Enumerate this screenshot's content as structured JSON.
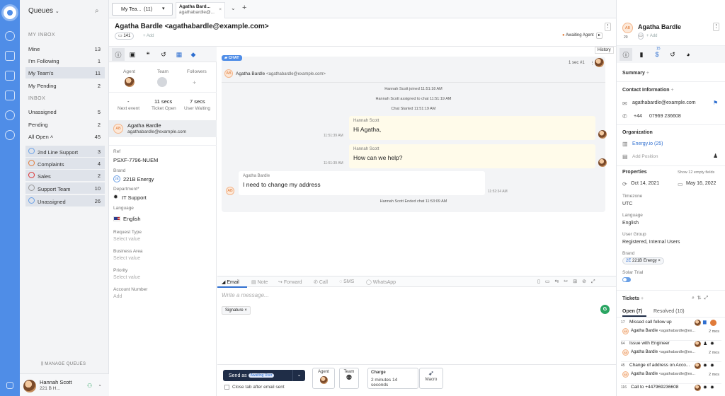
{
  "queues": {
    "title": "Queues",
    "my_inbox": "MY INBOX",
    "inbox": "INBOX",
    "manage": "MANAGE QUEUES",
    "my": [
      {
        "label": "Mine",
        "count": "13"
      },
      {
        "label": "I'm Following",
        "count": "1"
      },
      {
        "label": "My Team's",
        "count": "11"
      },
      {
        "label": "My Pending",
        "count": "2"
      }
    ],
    "inbox_items": [
      {
        "label": "Unassigned",
        "count": "5"
      },
      {
        "label": "Pending",
        "count": "2"
      },
      {
        "label": "All Open",
        "count": "45"
      }
    ],
    "sub": [
      {
        "label": "2nd Line Support",
        "count": "3"
      },
      {
        "label": "Complaints",
        "count": "4"
      },
      {
        "label": "Sales",
        "count": "2"
      },
      {
        "label": "Support Team",
        "count": "10"
      },
      {
        "label": "Unassigned",
        "count": "26"
      }
    ],
    "user": {
      "name": "Hannah Scott",
      "sub": "221 B H..."
    }
  },
  "tabs": {
    "team": "My Tea...",
    "team_count": "(11)",
    "active_title": "Agatha Bard...",
    "active_sub": "agathabardle@..."
  },
  "ticket": {
    "title": "Agatha Bardle <agathabardle@example.com>",
    "id": "141",
    "add": "+ Add",
    "status": "Awaiting Agent",
    "history": "History"
  },
  "props": {
    "agent": "Agent",
    "team": "Team",
    "followers": "Followers",
    "next_event_val": "-",
    "next_event": "Next event",
    "open_val": "11 secs",
    "open": "Ticket Open",
    "wait_val": "7 secs",
    "wait": "User Waiting",
    "contact_initials": "AB",
    "contact_name": "Agatha Bardle",
    "contact_email": "agathabardle@example.com",
    "ref_l": "Ref",
    "ref": "PSXF-7796-NUEM",
    "brand_l": "Brand",
    "brand_badge": "2E",
    "brand": "221B Energy",
    "dept_l": "Department*",
    "dept": "IT Support",
    "lang_l": "Language",
    "lang": "English",
    "req_l": "Request Type",
    "req": "Select value",
    "area_l": "Business Area",
    "area": "Select value",
    "prio_l": "Priority",
    "prio": "Select value",
    "acc_l": "Account Number",
    "acc": "Add"
  },
  "chat": {
    "badge": "CHAT",
    "who": "Agatha Bardle",
    "who_email": "<agathabardle@example.com>",
    "time": "1 sec",
    "num": "#1",
    "sys1": "Hannah Scott  joined   11:51:18 AM",
    "sys2": "Hannah Scott  assigned to chat   11:51:19 AM",
    "sys3": "Chat Started   11:51:19 AM",
    "m1_name": "Hannah Scott",
    "m1": "Hi Agatha,",
    "m1_t": "11:51:39 AM",
    "m2_name": "Hannah Scott",
    "m2": "How can we help?",
    "m2_t": "11:51:39 AM",
    "m3_name": "Agatha Bardle",
    "m3": "I need to change my address",
    "m3_t": "11:52:34 AM",
    "sys4": "Hannah Scott  Ended chat  11:53:09 AM"
  },
  "composer": {
    "email": "Email",
    "note": "Note",
    "forward": "Forward",
    "call": "Call",
    "sms": "SMS",
    "whatsapp": "WhatsApp",
    "placeholder": "Write a message...",
    "signature": "Signature ×",
    "send": "Send as",
    "send_badge": "Awaiting User",
    "close_tab": "Close tab after email sent",
    "agent": "Agent",
    "team": "Team",
    "charge": "Charge",
    "charge_val": "2 minutes 14 seconds",
    "macro": "Macro"
  },
  "contact": {
    "initials": "AB",
    "name": "Agatha Bardle",
    "count": "20",
    "add": "+ Add",
    "summary": "Summary",
    "info": "Contact Information",
    "email": "agathabardle@example.com",
    "phone_cc": "+44",
    "phone": "07969 236608",
    "org": "Organization",
    "org_name": "Energy.io (25)",
    "add_pos": "Add Position",
    "properties": "Properties",
    "show_empty": "Show 12 empty fields",
    "date1": "Oct 14, 2021",
    "date2": "May 16, 2022",
    "tz_l": "Timezone",
    "tz": "UTC",
    "lang_l": "Language",
    "lang": "English",
    "ug_l": "User Group",
    "ug": "Registered, Internal Users",
    "brand_l": "Brand",
    "brand": "221B Energy",
    "trial_l": "Solar Trial",
    "tickets": "Tickets",
    "open_tab": "Open (7)",
    "resolved_tab": "Resolved (10)",
    "tab_count": "15",
    "tlist": [
      {
        "id": "17",
        "title": "Missed call follow up",
        "who": "Agatha Bardle",
        "email": "<agathabardle@ex...",
        "age": "2 mos"
      },
      {
        "id": "64",
        "title": "Issue with Engineer",
        "who": "Agatha Bardle",
        "email": "<agathabardle@ex...",
        "age": "2 mos"
      },
      {
        "id": "45",
        "title": "Change of address on Acco...",
        "who": "Agatha Bardle",
        "email": "<agathabardle@ex...",
        "age": "2 mos"
      },
      {
        "id": "116",
        "title": "Call to +447969236608",
        "who": "",
        "email": "",
        "age": ""
      }
    ]
  },
  "colors": {
    "rail": "#4f8de7",
    "accent": "#2f6fd0",
    "status": "#e07b39",
    "green": "#2aa562",
    "send": "#1f2d47"
  }
}
